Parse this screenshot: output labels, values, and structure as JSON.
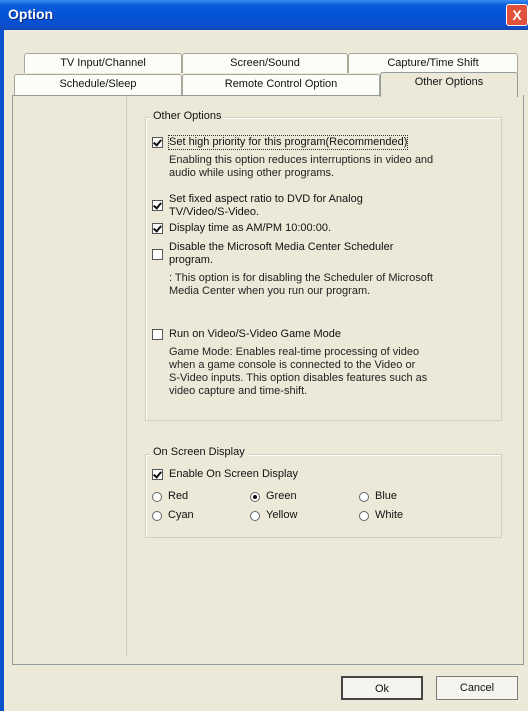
{
  "window": {
    "title": "Option",
    "close_glyph": "X"
  },
  "tabs": {
    "row1": [
      "TV Input/Channel",
      "Screen/Sound",
      "Capture/Time Shift"
    ],
    "row2": [
      "Schedule/Sleep",
      "Remote Control Option",
      "Other Options"
    ],
    "selected": "Other Options"
  },
  "other_options": {
    "group_label": "Other Options",
    "items": [
      {
        "label": "Set high priority for this program(Recommended)",
        "checked": true,
        "desc": [
          "Enabling this option reduces interruptions in video and",
          "audio while using other programs."
        ]
      },
      {
        "label": [
          "Set fixed aspect ratio to DVD for Analog",
          "TV/Video/S-Video."
        ],
        "checked": true
      },
      {
        "label": "Display time as AM/PM 10:00:00.",
        "checked": true
      },
      {
        "label": [
          "Disable the Microsoft Media Center Scheduler",
          "program."
        ],
        "checked": false,
        "desc": [
          " : This option is for disabling the Scheduler of Microsoft",
          "Media Center when you run our program."
        ]
      },
      {
        "label": "Run on Video/S-Video Game Mode",
        "checked": false,
        "desc": [
          "Game Mode:  Enables real-time processing of video",
          "when a game console is connected to the Video or",
          "S-Video inputs.  This option disables features such as",
          "video capture and time-shift."
        ]
      }
    ]
  },
  "osd": {
    "group_label": "On Screen Display",
    "enable_label": "Enable On Screen Display",
    "enable_checked": true,
    "colors": [
      "Red",
      "Green",
      "Blue",
      "Cyan",
      "Yellow",
      "White"
    ],
    "selected_color": "Green"
  },
  "buttons": {
    "ok": "Ok",
    "cancel": "Cancel"
  }
}
